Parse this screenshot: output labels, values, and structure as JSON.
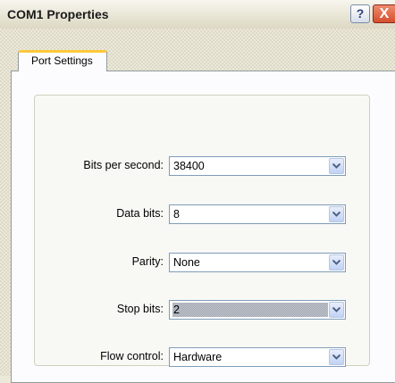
{
  "window": {
    "title": "COM1 Properties",
    "help_label": "?",
    "close_label": "X"
  },
  "tabs": [
    {
      "label": "Port Settings",
      "active": true
    }
  ],
  "fields": [
    {
      "label": "Bits per second:",
      "value": "38400"
    },
    {
      "label": "Data bits:",
      "value": "8"
    },
    {
      "label": "Parity:",
      "value": "None"
    },
    {
      "label": "Stop bits:",
      "value": "2",
      "focused": true
    },
    {
      "label": "Flow control:",
      "value": "Hardware"
    }
  ],
  "colors": {
    "tab_accent": "#ffc83c",
    "field_border": "#7f9db9",
    "close_button": "#d44f2c"
  },
  "icons": {
    "help": "question-mark-icon",
    "close": "close-icon",
    "dropdown": "chevron-down-icon"
  }
}
